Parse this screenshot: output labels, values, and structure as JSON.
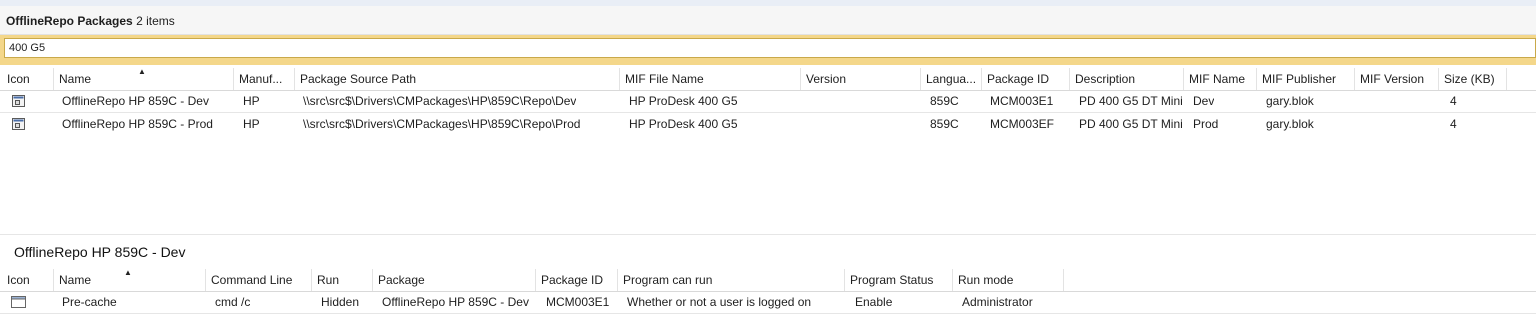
{
  "top_panel": {
    "title_bold": "OfflineRepo Packages",
    "title_count": "2 items",
    "search_value": "400 G5",
    "columns": [
      "Icon",
      "Name",
      "Manuf...",
      "Package Source Path",
      "MIF File Name",
      "Version",
      "Langua...",
      "Package ID",
      "Description",
      "MIF Name",
      "MIF Publisher",
      "MIF Version",
      "Size (KB)"
    ],
    "rows": [
      {
        "name": "OfflineRepo HP 859C - Dev",
        "manufacturer": "HP",
        "source_path": "\\\\src\\src$\\Drivers\\CMPackages\\HP\\859C\\Repo\\Dev",
        "mif_file_name": "HP ProDesk 400 G5",
        "version": "",
        "language": "859C",
        "package_id": "MCM003E1",
        "description": "PD 400 G5 DT Mini",
        "mif_name": "Dev",
        "mif_publisher": "gary.blok",
        "mif_version": "",
        "size_kb": "4",
        "icon": "package-icon"
      },
      {
        "name": "OfflineRepo HP 859C - Prod",
        "manufacturer": "HP",
        "source_path": "\\\\src\\src$\\Drivers\\CMPackages\\HP\\859C\\Repo\\Prod",
        "mif_file_name": "HP ProDesk 400 G5",
        "version": "",
        "language": "859C",
        "package_id": "MCM003EF",
        "description": "PD 400 G5 DT Mini",
        "mif_name": "Prod",
        "mif_publisher": "gary.blok",
        "mif_version": "",
        "size_kb": "4",
        "icon": "package-icon"
      }
    ]
  },
  "bottom_panel": {
    "title": "OfflineRepo HP 859C - Dev",
    "columns": [
      "Icon",
      "Name",
      "Command Line",
      "Run",
      "Package",
      "Package ID",
      "Program can run",
      "Program Status",
      "Run mode"
    ],
    "rows": [
      {
        "name": "Pre-cache",
        "command_line": "cmd /c",
        "run": "Hidden",
        "package": "OfflineRepo HP 859C - Dev",
        "package_id": "MCM003E1",
        "program_can_run": "Whether or not a user is logged on",
        "program_status": "Enable",
        "run_mode": "Administrator",
        "icon": "program-icon"
      }
    ]
  },
  "colors": {
    "search_border": "#f4d78a",
    "header_text": "#1e1e1e"
  }
}
